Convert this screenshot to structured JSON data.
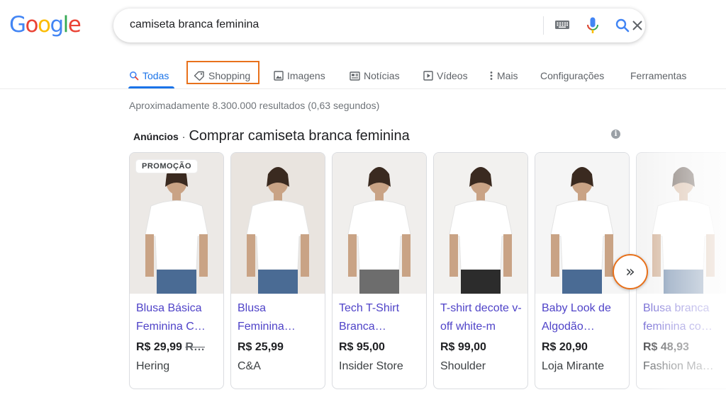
{
  "logo": {
    "letters": [
      "G",
      "o",
      "o",
      "g",
      "l",
      "e"
    ],
    "colors": [
      "#4285f4",
      "#ea4335",
      "#fbbc05",
      "#4285f4",
      "#34a853",
      "#ea4335"
    ]
  },
  "search": {
    "query": "camiseta branca feminina"
  },
  "icons": {
    "clear": "close-icon",
    "keyboard": "keyboard-icon",
    "voice": "mic-icon",
    "search": "search-icon"
  },
  "tabs": [
    {
      "label": "Todas",
      "icon": "search-icon",
      "active": true
    },
    {
      "label": "Shopping",
      "icon": "tag-icon",
      "active": false
    },
    {
      "label": "Imagens",
      "icon": "image-icon",
      "active": false
    },
    {
      "label": "Notícias",
      "icon": "news-icon",
      "active": false
    },
    {
      "label": "Vídeos",
      "icon": "play-icon",
      "active": false
    },
    {
      "label": "Mais",
      "icon": "more-vert-icon",
      "active": false
    },
    {
      "label": "Configurações",
      "icon": "",
      "active": false
    },
    {
      "label": "Ferramentas",
      "icon": "",
      "active": false
    }
  ],
  "stats": "Aproximadamente 8.300.000 resultados (0,63 segundos)",
  "ads": {
    "label": "Anúncios",
    "separator": "·",
    "title": "Comprar camiseta branca feminina",
    "info": "i"
  },
  "products": [
    {
      "name": "Blusa Básica Feminina C…",
      "price": "R$ 29,99",
      "old_price": "R…",
      "store": "Hering",
      "badge": "PROMOÇÃO",
      "bg": "#ece9e6"
    },
    {
      "name": "Blusa Feminina…",
      "price": "R$ 25,99",
      "old_price": "",
      "store": "C&A",
      "badge": "",
      "bg": "#e9e4df"
    },
    {
      "name": "Tech T-Shirt Branca…",
      "price": "R$ 95,00",
      "old_price": "",
      "store": "Insider Store",
      "badge": "",
      "bg": "#f0eeec"
    },
    {
      "name": "T-shirt decote v-off white-m",
      "price": "R$ 99,00",
      "old_price": "",
      "store": "Shoulder",
      "badge": "",
      "bg": "#f2f1ef"
    },
    {
      "name": "Baby Look de Algodão…",
      "price": "R$ 20,90",
      "old_price": "",
      "store": "Loja Mirante",
      "badge": "",
      "bg": "#f5f5f5"
    },
    {
      "name": "Blusa branca feminina co…",
      "price": "R$ 48,93",
      "old_price": "",
      "store": "Fashion Ma…",
      "badge": "",
      "bg": "#f2f2f2"
    }
  ],
  "next_button": "»",
  "accent_colors": {
    "link": "#4f43c8",
    "active_tab": "#1a73e8",
    "highlight": "#e8711b"
  }
}
